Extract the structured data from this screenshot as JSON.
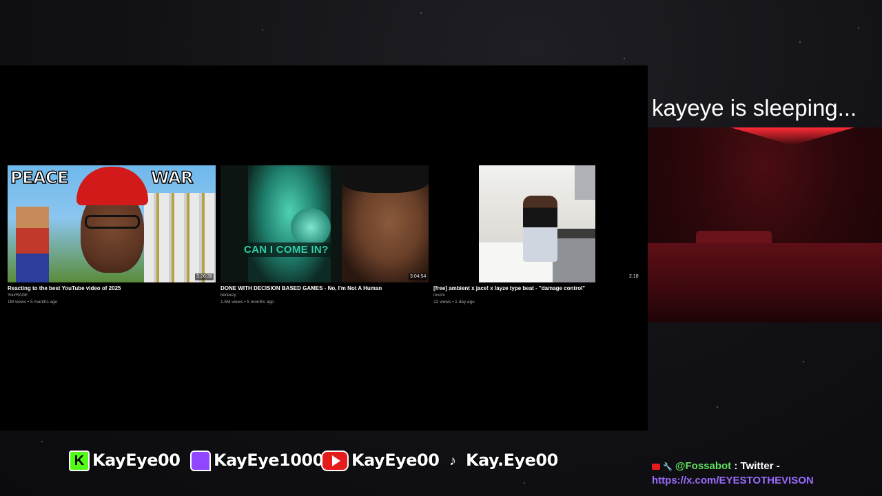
{
  "stream": {
    "status_text": "kayeye is sleeping..."
  },
  "videos": [
    {
      "title": "Reacting to the best YouTube video of 2025",
      "channel": "YourRAGE",
      "meta": "1M views • 5 months ago",
      "duration": "3:26:30",
      "thumb_text_left": "PEACE",
      "thumb_text_right": "WAR"
    },
    {
      "title": "DONE WITH DECISION BASED GAMES - No, I'm Not A Human",
      "channel": "berleezy",
      "meta": "1.5M views • 5 months ago",
      "duration": "3:04:54",
      "thumb_caption": "CAN I COME IN?"
    },
    {
      "title": "[free] ambient x jace! x layze type beat - \"damage control\"",
      "channel": "revoni",
      "meta": "22 views • 1 day ago",
      "duration": "2:18"
    }
  ],
  "socials": [
    {
      "platform_icon": "kick-icon",
      "glyph": "K",
      "name": "KayEye00"
    },
    {
      "platform_icon": "twitch-icon",
      "glyph": "",
      "name": "KayEye1000"
    },
    {
      "platform_icon": "youtube-icon",
      "glyph": "",
      "name": "KayEye00"
    },
    {
      "platform_icon": "tiktok-icon",
      "glyph": "♪",
      "name": "Kay.Eye00"
    }
  ],
  "chat": {
    "user": "@Fossabot",
    "message": " : Twitter -",
    "link": "https://x.com/EYESTOTHEVISON"
  },
  "colors": {
    "kick": "#53fc18",
    "twitch": "#9146ff",
    "youtube": "#e61c1c",
    "chat_user": "#5fe15f",
    "chat_link": "#9b6bff"
  }
}
